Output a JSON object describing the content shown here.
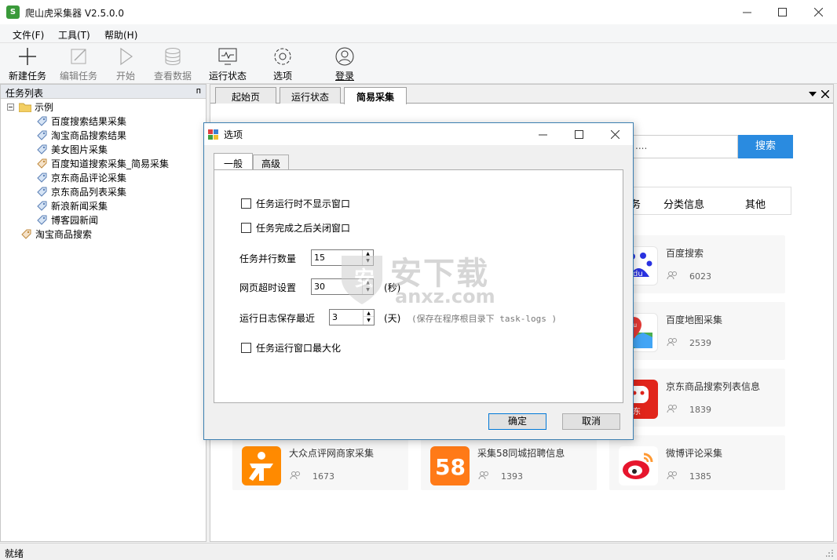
{
  "window": {
    "title": "爬山虎采集器 V2.5.0.0"
  },
  "menu": [
    "文件(F)",
    "工具(T)",
    "帮助(H)"
  ],
  "toolbar": {
    "new_task": "新建任务",
    "edit_task": "编辑任务",
    "start": "开始",
    "view_data": "查看数据",
    "run_status": "运行状态",
    "options": "选项",
    "login": "登录"
  },
  "left_panel": {
    "title": "任务列表",
    "pin": "ᴨ",
    "root_folder": "示例",
    "tree_items": [
      "百度搜索结果采集",
      "淘宝商品搜索结果",
      "美女图片采集",
      "百度知道搜索采集_简易采集",
      "京东商品评论采集",
      "京东商品列表采集",
      "新浪新闻采集",
      "博客园新闻"
    ],
    "root_item": "淘宝商品搜索"
  },
  "tabs": [
    "起始页",
    "运行状态",
    "简易采集"
  ],
  "search": {
    "placeholder": "....",
    "button": "搜索"
  },
  "categories": [
    "务",
    "分类信息",
    "其他"
  ],
  "cards": [
    {
      "name": "百度搜索",
      "count": "6023"
    },
    {
      "name": "百度地图采集",
      "count": "2539"
    },
    {
      "name": "京东商品搜索列表信息",
      "count": "1839"
    },
    {
      "name": "大众点评网商家采集",
      "count": "1673"
    },
    {
      "name": "采集58同城招聘信息",
      "count": "1393"
    },
    {
      "name": "微博评论采集",
      "count": "1385"
    }
  ],
  "status": "就绪",
  "dialog": {
    "title": "选项",
    "tabs": [
      "一般",
      "高级"
    ],
    "chk_hide": "任务运行时不显示窗口",
    "chk_close": "任务完成之后关闭窗口",
    "parallel_label": "任务并行数量",
    "parallel_value": "15",
    "timeout_label": "网页超时设置",
    "timeout_value": "30",
    "timeout_unit": "(秒)",
    "log_label": "运行日志保存最近",
    "log_value": "3",
    "log_unit": "(天)",
    "log_hint": "(保存在程序根目录下 task-logs )",
    "chk_max": "任务运行窗口最大化",
    "ok": "确定",
    "cancel": "取消"
  },
  "watermark": {
    "cn": "安下载",
    "en": "anxz.com"
  },
  "colors": {
    "accent": "#2a8be0",
    "dialog_border": "#3c7fb1"
  }
}
